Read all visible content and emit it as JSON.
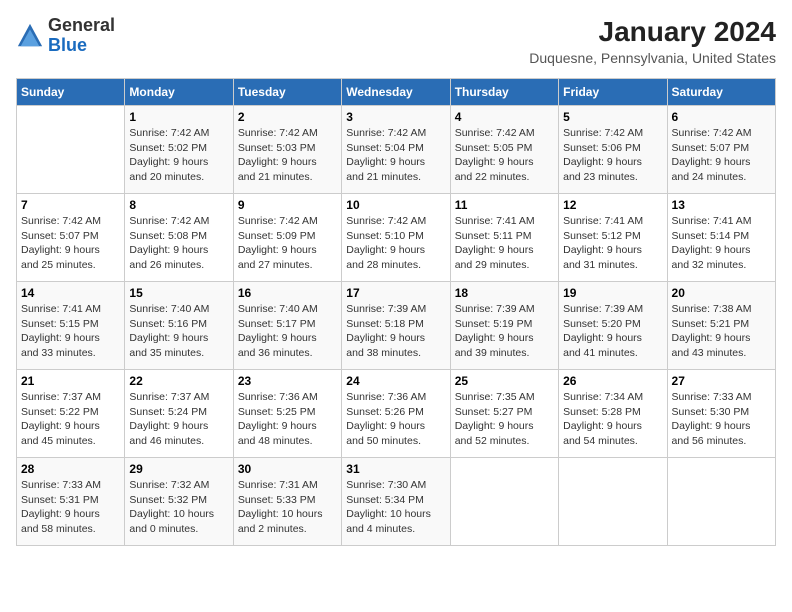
{
  "header": {
    "logo": {
      "general": "General",
      "blue": "Blue"
    },
    "title": "January 2024",
    "location": "Duquesne, Pennsylvania, United States"
  },
  "days_of_week": [
    "Sunday",
    "Monday",
    "Tuesday",
    "Wednesday",
    "Thursday",
    "Friday",
    "Saturday"
  ],
  "weeks": [
    [
      {
        "day": "",
        "info": ""
      },
      {
        "day": "1",
        "info": "Sunrise: 7:42 AM\nSunset: 5:02 PM\nDaylight: 9 hours\nand 20 minutes."
      },
      {
        "day": "2",
        "info": "Sunrise: 7:42 AM\nSunset: 5:03 PM\nDaylight: 9 hours\nand 21 minutes."
      },
      {
        "day": "3",
        "info": "Sunrise: 7:42 AM\nSunset: 5:04 PM\nDaylight: 9 hours\nand 21 minutes."
      },
      {
        "day": "4",
        "info": "Sunrise: 7:42 AM\nSunset: 5:05 PM\nDaylight: 9 hours\nand 22 minutes."
      },
      {
        "day": "5",
        "info": "Sunrise: 7:42 AM\nSunset: 5:06 PM\nDaylight: 9 hours\nand 23 minutes."
      },
      {
        "day": "6",
        "info": "Sunrise: 7:42 AM\nSunset: 5:07 PM\nDaylight: 9 hours\nand 24 minutes."
      }
    ],
    [
      {
        "day": "7",
        "info": "Sunrise: 7:42 AM\nSunset: 5:07 PM\nDaylight: 9 hours\nand 25 minutes."
      },
      {
        "day": "8",
        "info": "Sunrise: 7:42 AM\nSunset: 5:08 PM\nDaylight: 9 hours\nand 26 minutes."
      },
      {
        "day": "9",
        "info": "Sunrise: 7:42 AM\nSunset: 5:09 PM\nDaylight: 9 hours\nand 27 minutes."
      },
      {
        "day": "10",
        "info": "Sunrise: 7:42 AM\nSunset: 5:10 PM\nDaylight: 9 hours\nand 28 minutes."
      },
      {
        "day": "11",
        "info": "Sunrise: 7:41 AM\nSunset: 5:11 PM\nDaylight: 9 hours\nand 29 minutes."
      },
      {
        "day": "12",
        "info": "Sunrise: 7:41 AM\nSunset: 5:12 PM\nDaylight: 9 hours\nand 31 minutes."
      },
      {
        "day": "13",
        "info": "Sunrise: 7:41 AM\nSunset: 5:14 PM\nDaylight: 9 hours\nand 32 minutes."
      }
    ],
    [
      {
        "day": "14",
        "info": "Sunrise: 7:41 AM\nSunset: 5:15 PM\nDaylight: 9 hours\nand 33 minutes."
      },
      {
        "day": "15",
        "info": "Sunrise: 7:40 AM\nSunset: 5:16 PM\nDaylight: 9 hours\nand 35 minutes."
      },
      {
        "day": "16",
        "info": "Sunrise: 7:40 AM\nSunset: 5:17 PM\nDaylight: 9 hours\nand 36 minutes."
      },
      {
        "day": "17",
        "info": "Sunrise: 7:39 AM\nSunset: 5:18 PM\nDaylight: 9 hours\nand 38 minutes."
      },
      {
        "day": "18",
        "info": "Sunrise: 7:39 AM\nSunset: 5:19 PM\nDaylight: 9 hours\nand 39 minutes."
      },
      {
        "day": "19",
        "info": "Sunrise: 7:39 AM\nSunset: 5:20 PM\nDaylight: 9 hours\nand 41 minutes."
      },
      {
        "day": "20",
        "info": "Sunrise: 7:38 AM\nSunset: 5:21 PM\nDaylight: 9 hours\nand 43 minutes."
      }
    ],
    [
      {
        "day": "21",
        "info": "Sunrise: 7:37 AM\nSunset: 5:22 PM\nDaylight: 9 hours\nand 45 minutes."
      },
      {
        "day": "22",
        "info": "Sunrise: 7:37 AM\nSunset: 5:24 PM\nDaylight: 9 hours\nand 46 minutes."
      },
      {
        "day": "23",
        "info": "Sunrise: 7:36 AM\nSunset: 5:25 PM\nDaylight: 9 hours\nand 48 minutes."
      },
      {
        "day": "24",
        "info": "Sunrise: 7:36 AM\nSunset: 5:26 PM\nDaylight: 9 hours\nand 50 minutes."
      },
      {
        "day": "25",
        "info": "Sunrise: 7:35 AM\nSunset: 5:27 PM\nDaylight: 9 hours\nand 52 minutes."
      },
      {
        "day": "26",
        "info": "Sunrise: 7:34 AM\nSunset: 5:28 PM\nDaylight: 9 hours\nand 54 minutes."
      },
      {
        "day": "27",
        "info": "Sunrise: 7:33 AM\nSunset: 5:30 PM\nDaylight: 9 hours\nand 56 minutes."
      }
    ],
    [
      {
        "day": "28",
        "info": "Sunrise: 7:33 AM\nSunset: 5:31 PM\nDaylight: 9 hours\nand 58 minutes."
      },
      {
        "day": "29",
        "info": "Sunrise: 7:32 AM\nSunset: 5:32 PM\nDaylight: 10 hours\nand 0 minutes."
      },
      {
        "day": "30",
        "info": "Sunrise: 7:31 AM\nSunset: 5:33 PM\nDaylight: 10 hours\nand 2 minutes."
      },
      {
        "day": "31",
        "info": "Sunrise: 7:30 AM\nSunset: 5:34 PM\nDaylight: 10 hours\nand 4 minutes."
      },
      {
        "day": "",
        "info": ""
      },
      {
        "day": "",
        "info": ""
      },
      {
        "day": "",
        "info": ""
      }
    ]
  ]
}
